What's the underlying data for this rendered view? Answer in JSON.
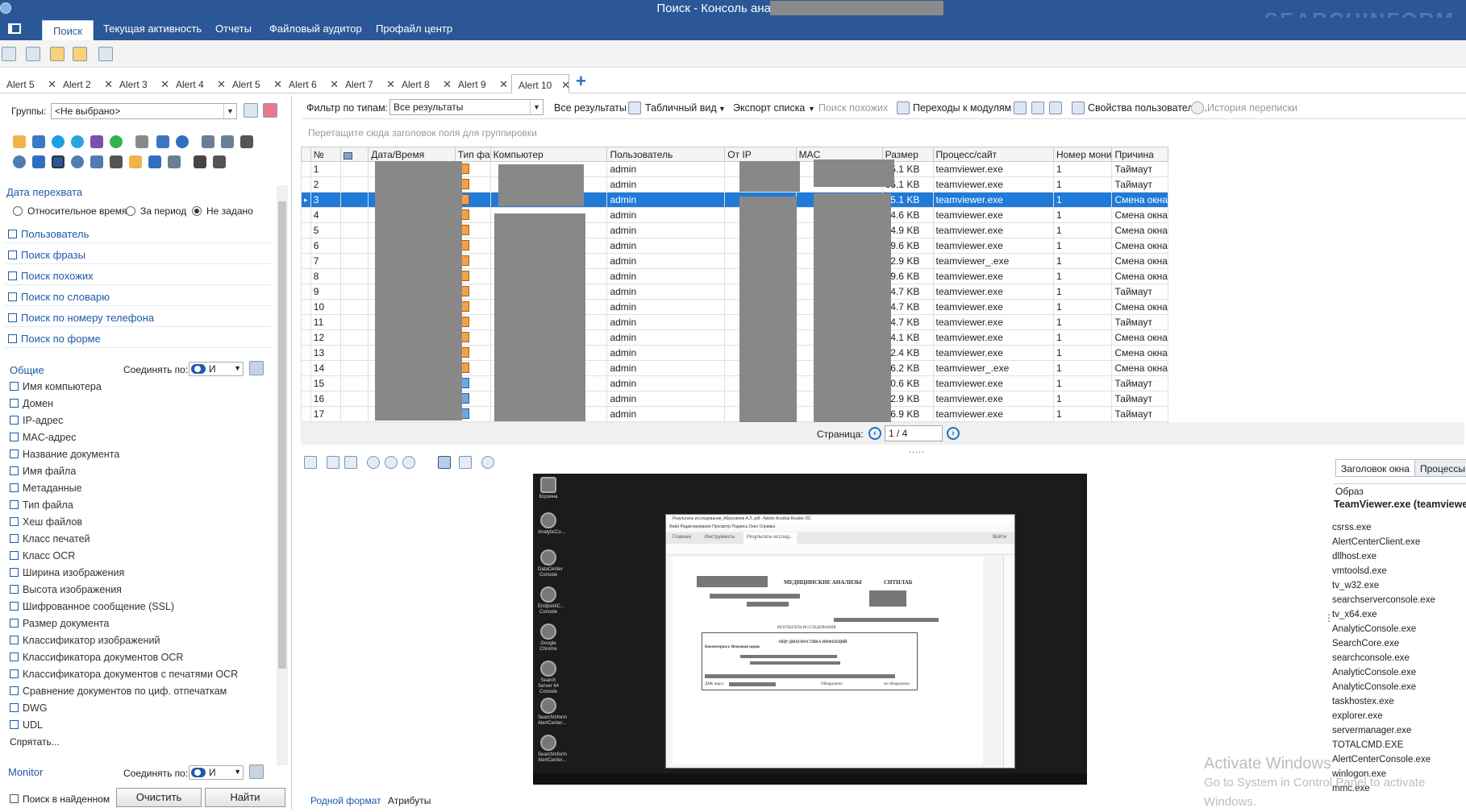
{
  "window": {
    "title": "Поиск - Консоль аналитика",
    "brand": "SEARCHINFORM"
  },
  "menu": {
    "items": [
      "Поиск",
      "Текущая активность",
      "Отчеты",
      "Файловый аудитор",
      "Профайл центр"
    ]
  },
  "tabs": [
    {
      "label": "Alert 5"
    },
    {
      "label": "Alert 2"
    },
    {
      "label": "Alert 3"
    },
    {
      "label": "Alert 4"
    },
    {
      "label": "Alert 5"
    },
    {
      "label": "Alert 6"
    },
    {
      "label": "Alert 7"
    },
    {
      "label": "Alert 8"
    },
    {
      "label": "Alert 9"
    },
    {
      "label": "Alert 10"
    }
  ],
  "left": {
    "groups_label": "Группы:",
    "groups_value": "<Не выбрано>",
    "date_section": "Дата перехвата",
    "radio": [
      "Относительное время",
      "За период",
      "Не задано"
    ],
    "collapsibles": [
      "Пользователь",
      "Поиск фразы",
      "Поиск похожих",
      "Поиск по словарю",
      "Поиск по номеру телефона",
      "Поиск по форме"
    ],
    "general": "Общие",
    "join_label": "Соединять по:",
    "join_value": "И",
    "attrs": [
      "Имя компьютера",
      "Домен",
      "IP-адрес",
      "MAC-адрес",
      "Название документа",
      "Имя файла",
      "Метаданные",
      "Тип файла",
      "Хеш файлов",
      "Класс печатей",
      "Класс OCR",
      "Ширина изображения",
      "Высота изображения",
      "Шифрованное сообщение (SSL)",
      "Размер документа",
      "Классификатор изображений",
      "Классификатора документов OCR",
      "Классификатора документов с печатями OCR",
      "Сравнение документов по циф. отпечаткам",
      "DWG",
      "UDL"
    ],
    "hide": "Спрятать...",
    "monitor": "Monitor",
    "search_in_found": "Поиск в найденном",
    "clear": "Очистить",
    "find": "Найти"
  },
  "filter": {
    "label": "Фильтр по типам:",
    "value": "Все результаты",
    "all_results": "Все результаты",
    "table_view": "Табличный вид",
    "export": "Экспорт списка",
    "similar": "Поиск похожих",
    "modules": "Переходы к модулям",
    "user_props": "Свойства пользователя...",
    "history": "История переписки",
    "group_hint": "Перетащите сюда заголовок поля для группировки"
  },
  "grid": {
    "columns": [
      "№",
      "",
      "Дата/Время",
      "Тип фа",
      "Компьютер",
      "Пользователь",
      "От IP",
      "MAC",
      "Размер",
      "Процесс/сайт",
      "Номер мони",
      "Причина"
    ],
    "rows": [
      {
        "n": "1",
        "user": "admin",
        "size": "35.1 KB",
        "proc": "teamviewer.exe",
        "mon": "1",
        "reason": "Таймаут",
        "img": false
      },
      {
        "n": "2",
        "user": "admin",
        "size": "35.1 KB",
        "proc": "teamviewer.exe",
        "mon": "1",
        "reason": "Таймаут",
        "img": false
      },
      {
        "n": "3",
        "user": "admin",
        "size": "35.1 KB",
        "proc": "teamviewer.exe",
        "mon": "1",
        "reason": "Смена окна",
        "img": false,
        "selected": true
      },
      {
        "n": "4",
        "user": "admin",
        "size": "34.6 KB",
        "proc": "teamviewer.exe",
        "mon": "1",
        "reason": "Смена окна",
        "img": false
      },
      {
        "n": "5",
        "user": "admin",
        "size": "34.9 KB",
        "proc": "teamviewer.exe",
        "mon": "1",
        "reason": "Смена окна",
        "img": false
      },
      {
        "n": "6",
        "user": "admin",
        "size": "49.6 KB",
        "proc": "teamviewer.exe",
        "mon": "1",
        "reason": "Смена окна",
        "img": false
      },
      {
        "n": "7",
        "user": "admin",
        "size": "42.9 KB",
        "proc": "teamviewer_.exe",
        "mon": "1",
        "reason": "Смена окна",
        "img": false
      },
      {
        "n": "8",
        "user": "admin",
        "size": "29.6 KB",
        "proc": "teamviewer.exe",
        "mon": "1",
        "reason": "Смена окна",
        "img": false
      },
      {
        "n": "9",
        "user": "admin",
        "size": "44.7 KB",
        "proc": "teamviewer.exe",
        "mon": "1",
        "reason": "Таймаут",
        "img": false
      },
      {
        "n": "10",
        "user": "admin",
        "size": "44.7 KB",
        "proc": "teamviewer.exe",
        "mon": "1",
        "reason": "Смена окна",
        "img": false
      },
      {
        "n": "11",
        "user": "admin",
        "size": "44.7 KB",
        "proc": "teamviewer.exe",
        "mon": "1",
        "reason": "Таймаут",
        "img": false
      },
      {
        "n": "12",
        "user": "admin",
        "size": "54.1 KB",
        "proc": "teamviewer.exe",
        "mon": "1",
        "reason": "Смена окна",
        "img": false
      },
      {
        "n": "13",
        "user": "admin",
        "size": "42.4 KB",
        "proc": "teamviewer.exe",
        "mon": "1",
        "reason": "Смена окна",
        "img": false
      },
      {
        "n": "14",
        "user": "admin",
        "size": "36.2 KB",
        "proc": "teamviewer_.exe",
        "mon": "1",
        "reason": "Смена окна",
        "img": false
      },
      {
        "n": "15",
        "user": "admin",
        "size": "50.6 KB",
        "proc": "teamviewer.exe",
        "mon": "1",
        "reason": "Таймаут",
        "img": true
      },
      {
        "n": "16",
        "user": "admin",
        "size": "42.9 KB",
        "proc": "teamviewer.exe",
        "mon": "1",
        "reason": "Таймаут",
        "img": true
      },
      {
        "n": "17",
        "user": "admin",
        "size": "46.9 KB",
        "proc": "teamviewer.exe",
        "mon": "1",
        "reason": "Таймаут",
        "img": true
      }
    ]
  },
  "pager": {
    "label": "Страница:",
    "value": "1 / 4"
  },
  "preview": {
    "acrobat_title": "Результаты исследования_Абросимов А.Л..pdf - Adobe Acrobat Reader DC",
    "acrobat_menu": "Файл   Редактирование   Просмотр   Подпись   Окно   Справка",
    "acrobat_tabs": [
      "Главная",
      "Инструменты",
      "Результаты исслед..."
    ],
    "signin": "Войти",
    "doc_heading": "МЕДИЦИНСКИЕ АНАЛИЗЫ",
    "doc_brand": "СИТИЛАБ",
    "doc_sub": "РЕЗУЛЬТАТЫ ИССЛЕДОВАНИЯ",
    "doc_pcr": "ПЦР-ДИАГНОСТИКА ИНФЕКЦИЙ",
    "doc_bio": "Биоматериал: Венозная кровь",
    "doc_row": "ДНК вирус",
    "doc_found": "Обнаружено",
    "doc_notfound": "не обнаружено",
    "desktop_icons": [
      "Корзина",
      "AnalyticCo...",
      "DataCenter Console",
      "EndpointC... Console",
      "Google Chrome",
      "Search Server 64 Console",
      "SearchInform AlertCenter...",
      "SearchInform AlertCenter..."
    ]
  },
  "right": {
    "tabs": [
      "Заголовок окна",
      "Процессы"
    ],
    "header": "Образ",
    "top": "TeamViewer.exe (teamviewer",
    "processes": [
      "csrss.exe",
      "AlertCenterClient.exe",
      "dllhost.exe",
      "vmtoolsd.exe",
      "tv_w32.exe",
      "searchserverconsole.exe",
      "tv_x64.exe",
      "AnalyticConsole.exe",
      "SearchCore.exe",
      "searchconsole.exe",
      "AnalyticConsole.exe",
      "AnalyticConsole.exe",
      "taskhostex.exe",
      "explorer.exe",
      "servermanager.exe",
      "TOTALCMD.EXE",
      "AlertCenterConsole.exe",
      "winlogon.exe",
      "mmc.exe"
    ]
  },
  "bottom_tabs": [
    "Родной формат",
    "Атрибуты"
  ],
  "watermark": {
    "line1": "Activate Windows",
    "line2": "Go to System in Control Panel to activate Windows."
  }
}
